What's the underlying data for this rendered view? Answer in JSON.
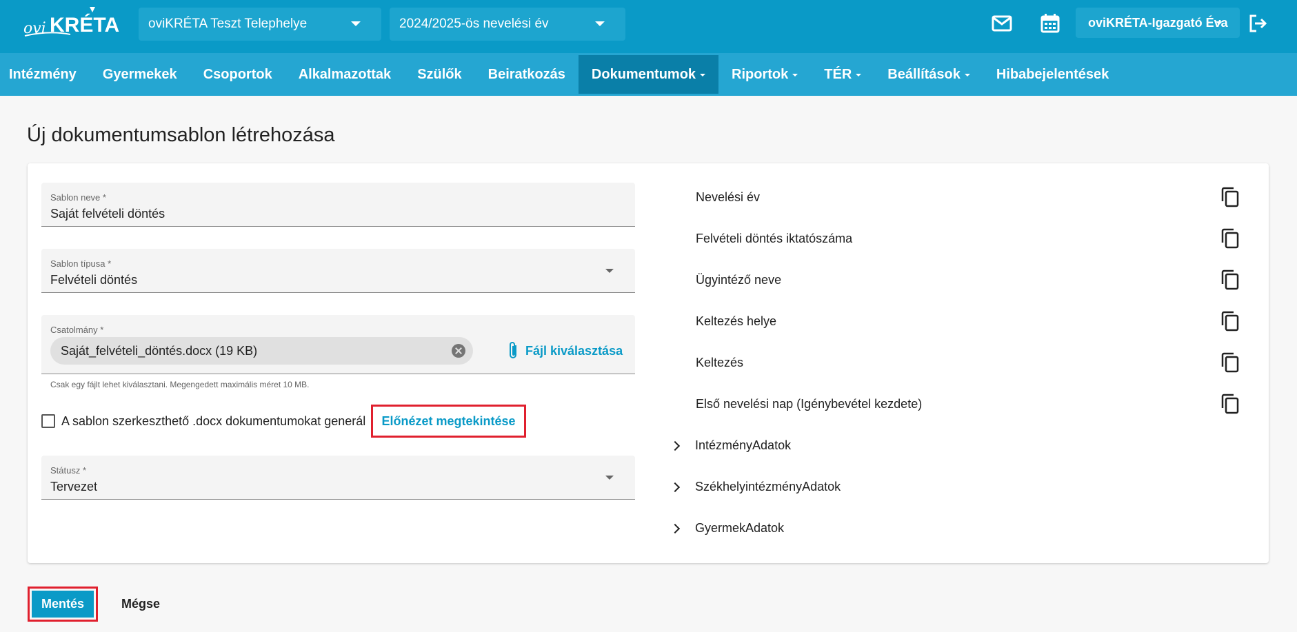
{
  "app": {
    "logo_text": "oviKRÉTA"
  },
  "header": {
    "site_select": "oviKRÉTA Teszt Telephelye",
    "year_select": "2024/2025-ös nevelési év",
    "user": "oviKRÉTA-Igazgató Éva",
    "icons": [
      "mail-icon",
      "calendar-icon",
      "logout-icon"
    ]
  },
  "nav": {
    "items": [
      {
        "label": "Intézmény",
        "dropdown": false
      },
      {
        "label": "Gyermekek",
        "dropdown": false
      },
      {
        "label": "Csoportok",
        "dropdown": false
      },
      {
        "label": "Alkalmazottak",
        "dropdown": false
      },
      {
        "label": "Szülők",
        "dropdown": false
      },
      {
        "label": "Beiratkozás",
        "dropdown": false
      },
      {
        "label": "Dokumentumok",
        "dropdown": true,
        "active": true
      },
      {
        "label": "Riportok",
        "dropdown": true
      },
      {
        "label": "TÉR",
        "dropdown": true
      },
      {
        "label": "Beállítások",
        "dropdown": true
      },
      {
        "label": "Hibabejelentések",
        "dropdown": false
      }
    ]
  },
  "page": {
    "title": "Új dokumentumsablon létrehozása"
  },
  "form": {
    "name_label": "Sablon neve *",
    "name_value": "Saját felvételi döntés",
    "type_label": "Sablon típusa *",
    "type_value": "Felvételi döntés",
    "attachment_label": "Csatolmány *",
    "attachment_file": "Saját_felvételi_döntés.docx (19 KB)",
    "attachment_button": "Fájl kiválasztása",
    "attachment_hint": "Csak egy fájlt lehet kiválasztani. Megengedett maximális méret 10 MB.",
    "checkbox_label": "A sablon szerkeszthető .docx dokumentumokat generál",
    "checkbox_checked": false,
    "preview_button": "Előnézet megtekintése",
    "status_label": "Státusz *",
    "status_value": "Tervezet"
  },
  "variables": {
    "items": [
      "Nevelési év",
      "Felvételi döntés iktatószáma",
      "Ügyintéző neve",
      "Keltezés helye",
      "Keltezés",
      "Első nevelési nap (Igénybevétel kezdete)"
    ],
    "groups": [
      "IntézményAdatok",
      "SzékhelyintézményAdatok",
      "GyermekAdatok"
    ]
  },
  "actions": {
    "save": "Mentés",
    "cancel": "Mégse"
  },
  "colors": {
    "primary": "#0a9ac7",
    "nav": "#25a6d2",
    "active_nav": "#0a7fa8",
    "highlight": "#e0202e"
  }
}
